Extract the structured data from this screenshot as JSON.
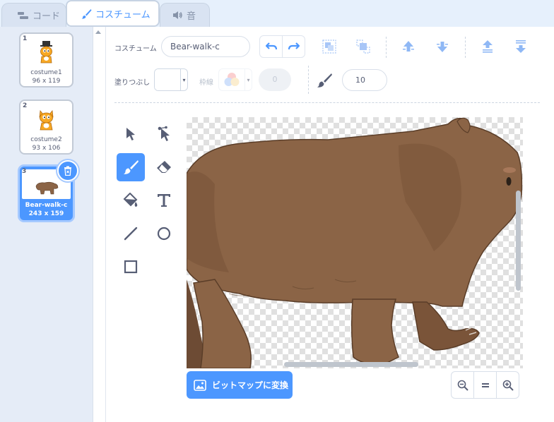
{
  "tabs": [
    {
      "label": "コード",
      "icon": "code-blocks-icon"
    },
    {
      "label": "コスチューム",
      "icon": "paintbrush-icon",
      "selected": true
    },
    {
      "label": "音",
      "icon": "speaker-icon"
    }
  ],
  "costumes": [
    {
      "number": "1",
      "name": "costume1",
      "size": "96 x 119",
      "thumbnail": "cat-with-top-hat"
    },
    {
      "number": "2",
      "name": "costume2",
      "size": "93 x 106",
      "thumbnail": "cat"
    },
    {
      "number": "3",
      "name": "Bear-walk-c",
      "size": "243 x 159",
      "thumbnail": "bear",
      "selected": true
    }
  ],
  "toolbar": {
    "costume_label": "コスチューム",
    "costume_name": "Bear-walk-c",
    "fill_label": "塗りつぶし",
    "fill_color": "#ffffff",
    "outline_label": "枠線",
    "outline_width": "0",
    "brush_size": "10",
    "buttons": [
      "undo-icon",
      "redo-icon",
      "group-icon",
      "ungroup-icon",
      "forward-icon",
      "backward-icon",
      "front-icon",
      "back-icon"
    ]
  },
  "tools": [
    "select-icon",
    "reshape-icon",
    "brush-icon",
    "eraser-icon",
    "fill-icon",
    "text-icon",
    "line-icon",
    "circle-icon",
    "rectangle-icon"
  ],
  "active_tool": "brush-icon",
  "canvas": {
    "convert_button": "ビットマップに変換",
    "zoom_buttons": [
      "zoom-out-icon",
      "zoom-reset-icon",
      "zoom-in-icon"
    ]
  },
  "colors": {
    "accent": "#4c97ff",
    "bear_fur": "#8b6446",
    "bear_dark": "#6d4b34"
  }
}
